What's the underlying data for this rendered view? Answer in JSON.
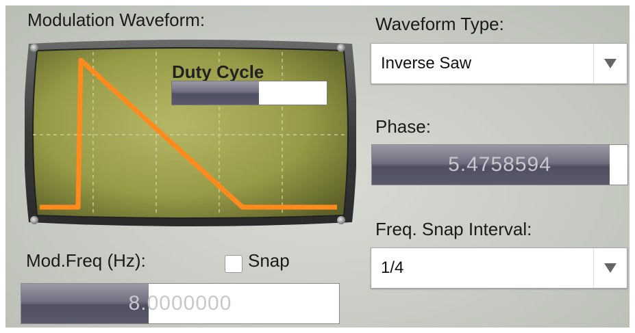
{
  "labels": {
    "modulation_waveform": "Modulation Waveform:",
    "waveform_type": "Waveform Type:",
    "phase": "Phase:",
    "freq_snap_interval": "Freq. Snap Interval:",
    "mod_freq": "Mod.Freq (Hz):",
    "snap": "Snap",
    "duty_cycle": "Duty Cycle"
  },
  "waveform_type": {
    "selected": "Inverse Saw",
    "arrow_icon": "triangle-down-icon"
  },
  "freq_snap": {
    "selected": "1/4",
    "arrow_icon": "triangle-down-icon"
  },
  "phase": {
    "value": "5.4758594",
    "fill_fraction": 0.93
  },
  "mod_freq": {
    "value": "8.0000000",
    "fill_fraction": 0.4
  },
  "duty_cycle": {
    "fill_fraction": 0.56
  },
  "snap": {
    "checked": false
  },
  "colors": {
    "waveform": "#ff8a1e",
    "scope_screen": "#9ea04a",
    "bar_fill": "#5a5a6e"
  }
}
